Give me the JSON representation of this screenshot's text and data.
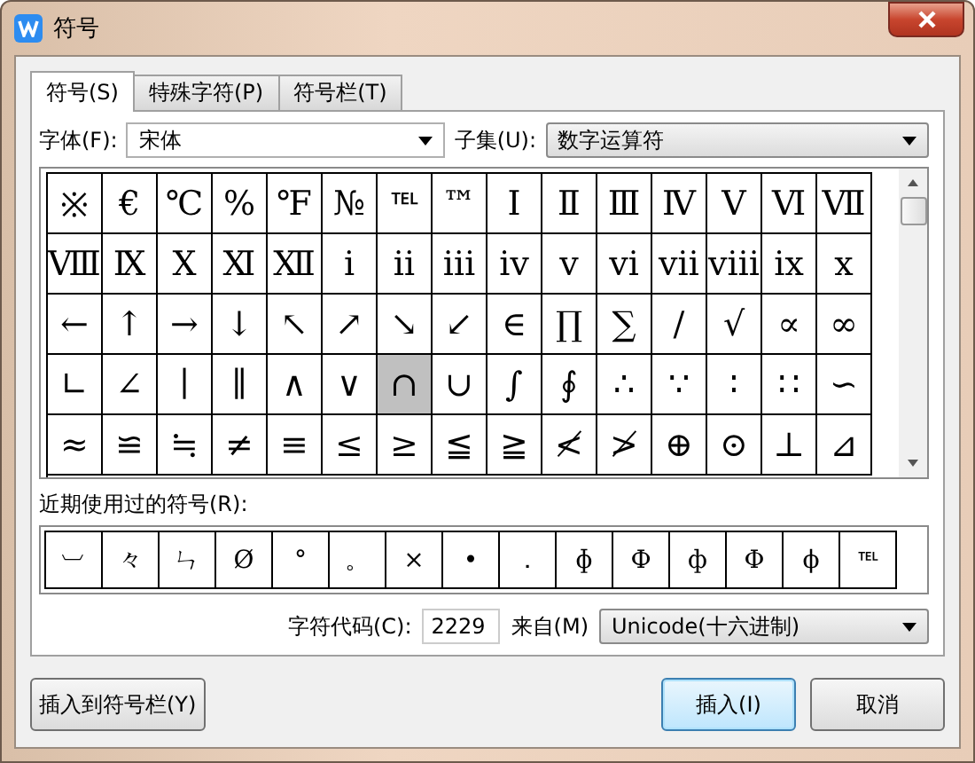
{
  "window": {
    "title": "符号"
  },
  "tabs": [
    {
      "label": "符号(S)",
      "selected": true
    },
    {
      "label": "特殊字符(P)",
      "selected": false
    },
    {
      "label": "符号栏(T)",
      "selected": false
    }
  ],
  "font": {
    "label": "字体(F):",
    "value": "宋体"
  },
  "subset": {
    "label": "子集(U):",
    "value": "数字运算符"
  },
  "symbols": [
    [
      {
        "char": "※",
        "selected": false
      },
      {
        "char": "€",
        "selected": false
      },
      {
        "char": "℃",
        "selected": false
      },
      {
        "char": "%",
        "selected": false
      },
      {
        "char": "℉",
        "selected": false
      },
      {
        "char": "№",
        "selected": false
      },
      {
        "char": "℡",
        "selected": false
      },
      {
        "char": "™",
        "selected": false
      },
      {
        "char": "Ⅰ",
        "selected": false
      },
      {
        "char": "Ⅱ",
        "selected": false
      },
      {
        "char": "Ⅲ",
        "selected": false
      },
      {
        "char": "Ⅳ",
        "selected": false
      },
      {
        "char": "Ⅴ",
        "selected": false
      },
      {
        "char": "Ⅵ",
        "selected": false
      },
      {
        "char": "Ⅶ",
        "selected": false
      }
    ],
    [
      {
        "char": "Ⅷ",
        "selected": false
      },
      {
        "char": "Ⅸ",
        "selected": false
      },
      {
        "char": "Ⅹ",
        "selected": false
      },
      {
        "char": "Ⅺ",
        "selected": false
      },
      {
        "char": "Ⅻ",
        "selected": false
      },
      {
        "char": "ⅰ",
        "selected": false
      },
      {
        "char": "ⅱ",
        "selected": false
      },
      {
        "char": "ⅲ",
        "selected": false
      },
      {
        "char": "ⅳ",
        "selected": false
      },
      {
        "char": "ⅴ",
        "selected": false
      },
      {
        "char": "ⅵ",
        "selected": false
      },
      {
        "char": "ⅶ",
        "selected": false
      },
      {
        "char": "ⅷ",
        "selected": false
      },
      {
        "char": "ⅸ",
        "selected": false
      },
      {
        "char": "ⅹ",
        "selected": false
      }
    ],
    [
      {
        "char": "←",
        "selected": false
      },
      {
        "char": "↑",
        "selected": false
      },
      {
        "char": "→",
        "selected": false
      },
      {
        "char": "↓",
        "selected": false
      },
      {
        "char": "↖",
        "selected": false
      },
      {
        "char": "↗",
        "selected": false
      },
      {
        "char": "↘",
        "selected": false
      },
      {
        "char": "↙",
        "selected": false
      },
      {
        "char": "∈",
        "selected": false
      },
      {
        "char": "∏",
        "selected": false
      },
      {
        "char": "∑",
        "selected": false
      },
      {
        "char": "∕",
        "selected": false
      },
      {
        "char": "√",
        "selected": false
      },
      {
        "char": "∝",
        "selected": false
      },
      {
        "char": "∞",
        "selected": false
      }
    ],
    [
      {
        "char": "∟",
        "selected": false
      },
      {
        "char": "∠",
        "selected": false
      },
      {
        "char": "∣",
        "selected": false
      },
      {
        "char": "∥",
        "selected": false
      },
      {
        "char": "∧",
        "selected": false
      },
      {
        "char": "∨",
        "selected": false
      },
      {
        "char": "∩",
        "selected": true
      },
      {
        "char": "∪",
        "selected": false
      },
      {
        "char": "∫",
        "selected": false
      },
      {
        "char": "∮",
        "selected": false
      },
      {
        "char": "∴",
        "selected": false
      },
      {
        "char": "∵",
        "selected": false
      },
      {
        "char": "∶",
        "selected": false
      },
      {
        "char": "∷",
        "selected": false
      },
      {
        "char": "∽",
        "selected": false
      }
    ],
    [
      {
        "char": "≈",
        "selected": false
      },
      {
        "char": "≌",
        "selected": false
      },
      {
        "char": "≒",
        "selected": false
      },
      {
        "char": "≠",
        "selected": false
      },
      {
        "char": "≡",
        "selected": false
      },
      {
        "char": "≤",
        "selected": false
      },
      {
        "char": "≥",
        "selected": false
      },
      {
        "char": "≦",
        "selected": false
      },
      {
        "char": "≧",
        "selected": false
      },
      {
        "char": "≮",
        "selected": false
      },
      {
        "char": "≯",
        "selected": false
      },
      {
        "char": "⊕",
        "selected": false
      },
      {
        "char": "⊙",
        "selected": false
      },
      {
        "char": "⊥",
        "selected": false
      },
      {
        "char": "⊿",
        "selected": false
      }
    ]
  ],
  "recent": {
    "label": "近期使用过的符号(R):",
    "symbols": [
      "︺",
      "々",
      "ㄣ",
      "Ø",
      "°",
      "。",
      "×",
      "•",
      "．",
      "ɸ",
      "Ф",
      "ф",
      "Φ",
      "ϕ",
      "℡"
    ]
  },
  "char_code": {
    "label": "字符代码(C):",
    "value": "2229"
  },
  "from": {
    "label": "来自(M)",
    "value": "Unicode(十六进制)"
  },
  "buttons": [
    {
      "label": "插入到符号栏(Y)",
      "kind": "plain"
    },
    {
      "label": "插入(I)",
      "kind": "default"
    },
    {
      "label": "取消",
      "kind": "plain"
    }
  ]
}
